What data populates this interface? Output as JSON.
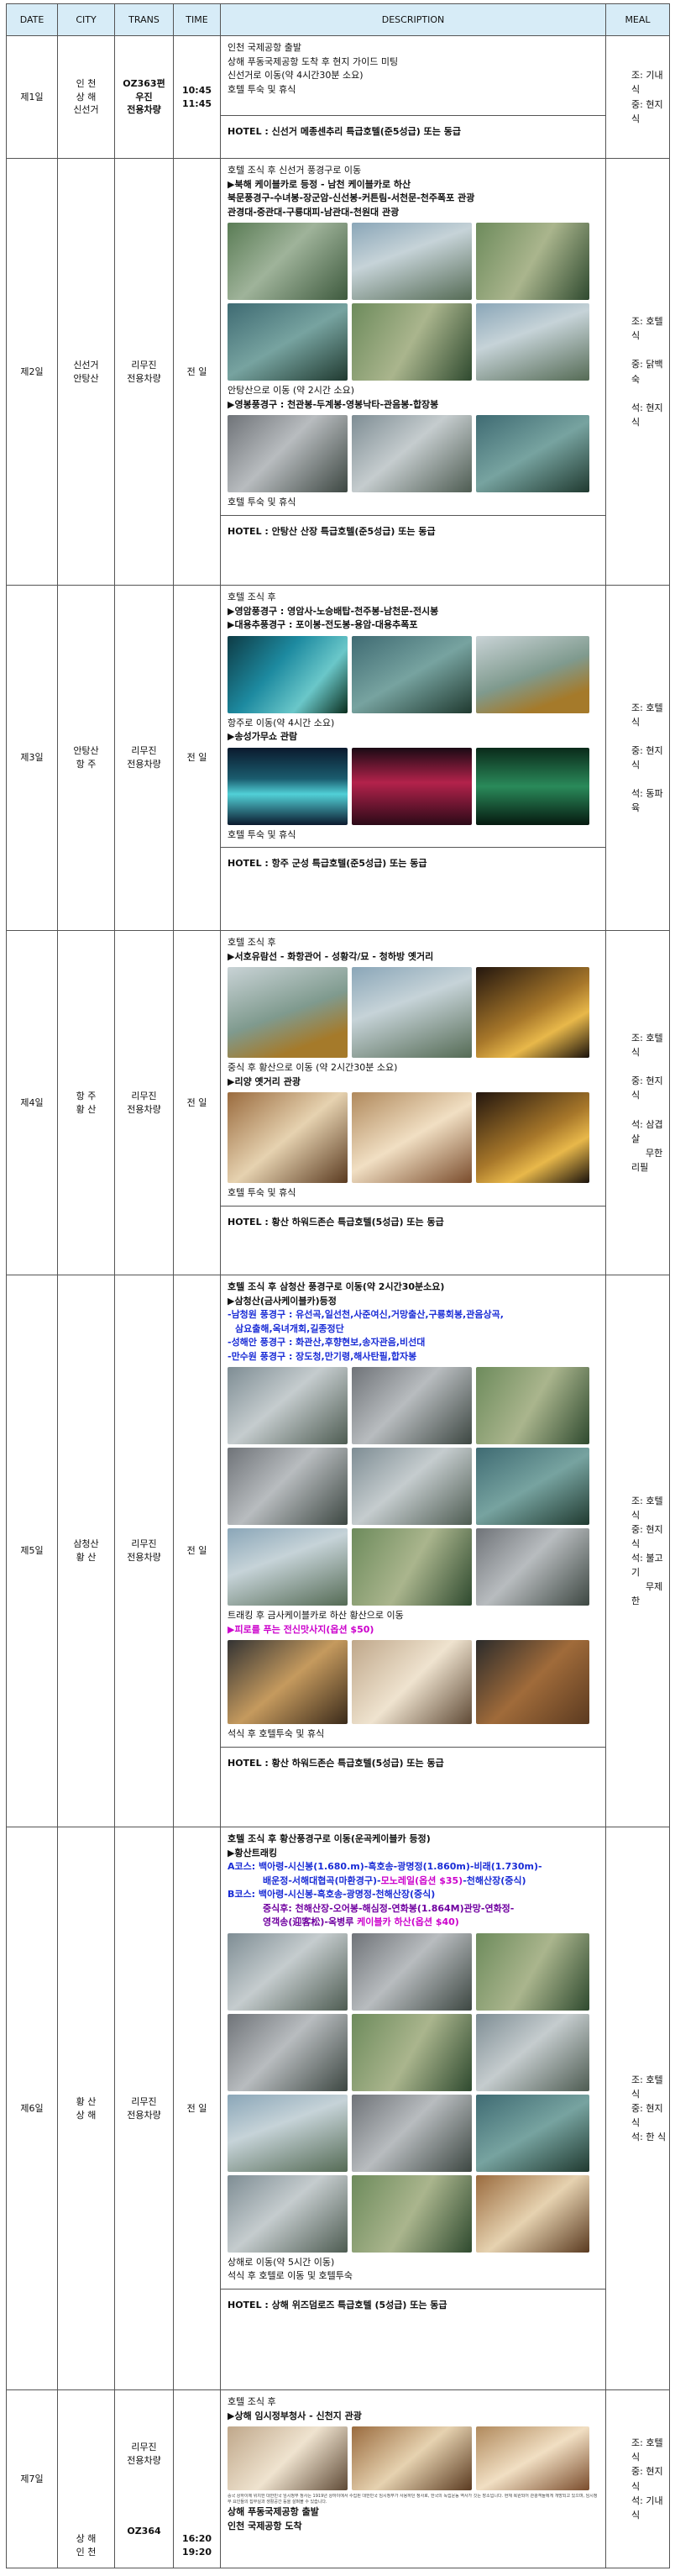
{
  "headers": [
    "DATE",
    "CITY",
    "TRANS",
    "TIME",
    "DESCRIPTION",
    "MEAL"
  ],
  "day1": {
    "date": "제1일",
    "city": [
      "인 천",
      "상 해",
      "신선거"
    ],
    "trans": [
      "OZ363편",
      "우진",
      "전용차량"
    ],
    "time": [
      "10:45",
      "11:45"
    ],
    "lines": [
      "인천 국제공항 출발",
      "상해 푸동국제공항 도착 후 현지 가이드 미팅",
      "신선거로 이동(약 4시간30분 소요)",
      "호텔 투숙 및 휴식"
    ],
    "hotel": "HOTEL : 신선거 메종센추리 특급호텔(준5성급) 또는 동급",
    "meal": [
      "조: 기내식",
      "중: 현지식"
    ]
  },
  "day2": {
    "date": "제2일",
    "city": [
      "신선거",
      "안탕산"
    ],
    "trans": [
      "리무진",
      "전용차량"
    ],
    "time": "전 일",
    "l1": "호텔 조식 후 신선거 풍경구로 이동",
    "l2": "▶북해 케이블카로 등정 - 남천 케이블카로 하산",
    "l3": "북문풍경구-수녀봉-장군암-신선봉-커튼림-서천문-천주폭포 관광",
    "l4": "관경대-중관대-구룡대피-남관대-천원대 관광",
    "l5": "안탕산으로 이동 (약 2시간 소요)",
    "l6": "▶영봉풍경구 : 천관봉-두계봉-영봉낙타-관음봉-합장봉",
    "l7": "호텔 투숙 및 휴식",
    "hotel": "HOTEL : 안탕산 산장 특급호텔(준5성급) 또는 동급",
    "meal": [
      "조: 호텔식",
      "중: 닭백숙",
      "석: 현지식"
    ]
  },
  "day3": {
    "date": "제3일",
    "city": [
      "안탕산",
      "항 주"
    ],
    "trans": [
      "리무진",
      "전용차량"
    ],
    "time": "전 일",
    "l1": "호텔 조식 후",
    "l2": "▶영암풍경구 : 영암사-노승배탑-천주봉-남천문-전시봉",
    "l3": "▶대용추풍경구 : 포이봉-전도봉-용암-대용추폭포",
    "l4": "항주로 이동(약 4시간 소요)",
    "l5": "▶송성가무쇼 관람",
    "l6": "호텔 투숙 및 휴식",
    "hotel": "HOTEL : 항주 군성 특급호텔(준5성급) 또는 동급",
    "meal": [
      "조: 호텔식",
      "중: 현지식",
      "석: 동파육"
    ]
  },
  "day4": {
    "date": "제4일",
    "city": [
      "항 주",
      "황 산"
    ],
    "trans": [
      "리무진",
      "전용차량"
    ],
    "time": "전 일",
    "l1": "호텔 조식 후",
    "l2": "▶서호유람선 - 화항관어 - 성황각/묘 - 청하방 옛거리",
    "l3": "중식 후 황산으로 이동 (약 2시간30분 소요)",
    "l4": "▶리양 옛거리 관광",
    "l5": "호텔 투숙 및 휴식",
    "hotel": "HOTEL : 황산 하워드존슨 특급호텔(5성급) 또는 동급",
    "meal": [
      "조: 호텔식",
      "중: 현지식",
      "석: 삼겹살",
      "무한리필"
    ]
  },
  "day5": {
    "date": "제5일",
    "city": [
      "삼청산",
      "황 산"
    ],
    "trans": [
      "리무진",
      "전용차량"
    ],
    "time": "전 일",
    "l1": "호텔 조식 후 삼청산 풍경구로 이동(약 2시간30분소요)",
    "l2": "▶삼청산(금사케이블카)등정",
    "l3": "-남청원 풍경구 : 유선곡,일선천,사준여신,거망출산,구룡회봉,관음상곡,",
    "l4": "삼요출해,옥녀개회,길종정단",
    "l5": "-성해안 풍경구 : 화관산,후향현보,송자관음,비선대",
    "l6": "-만수원 풍경구 : 장도청,만기령,해사탄필,합자봉",
    "l7": "트래킹 후 금사케이블카로 하산 황산으로 이동",
    "l8": "▶피로를 푸는 전신맛사지(옵션 $50)",
    "l9": "석식 후 호텔투숙 및 휴식",
    "hotel": "HOTEL : 황산 하워드존슨 특급호텔(5성급) 또는 동급",
    "meal": [
      "조: 호텔식",
      "중: 현지식",
      "석: 불고기",
      "무제한"
    ]
  },
  "day6": {
    "date": "제6일",
    "city": [
      "황 산",
      "상 해"
    ],
    "trans": [
      "리무진",
      "전용차량"
    ],
    "time": "전 일",
    "l1": "호텔 조식 후 황산풍경구로 이동(운곡케이블카 등정)",
    "l2": "▶황산트래킹",
    "a1": "A코스: 백아령-시신봉(1.680.m)-흑호송-광명정(1.860m)-비래(1.730m)-",
    "a2": "배운정-서해대협곡(마환경구)-",
    "a2opt": "모노레일(옵션 $35)",
    "a2end": "-천해산장(중식)",
    "b1": "B코스: 백아령-시신봉-흑호송-광명정-천해산장(중식)",
    "b2": "중식후: 천해산장-오어봉-해심정-연화봉(1.864M)관망-연화정-",
    "b3": "영객송(迎客松)-옥병루 ",
    "b3opt": "케이블카 하산(옵션 $40)",
    "l3": "상해로 이동(약 5시간 이동)",
    "l4": "석식 후 호텔로 이동 및 호텔투숙",
    "hotel": "HOTEL : 상해 위즈덤로즈 특급호텔 (5성급) 또는 동급",
    "meal": [
      "조: 호텔식",
      "중: 현지식",
      "석: 한 식"
    ]
  },
  "day7": {
    "date": "제7일",
    "trans_top": [
      "리무진",
      "전용차량"
    ],
    "city_bottom": [
      "상 해",
      "인 천"
    ],
    "trans_bottom": "OZ364",
    "time": [
      "16:20",
      "19:20"
    ],
    "l1": "호텔 조식 후",
    "l2": "▶상해 임시정부청사 - 신천지 관광",
    "note": "중국 상하이에 위치한 대한민국 임시정부 청사는 1919년 상하이에서 수립된 대한민국 임시정부가 사용하던 청사로, 한국의 독립운동 역사가 깃든 장소입니다. 현재 복원되어 관광객들에게 개방되고 있으며, 임시정부 요인들의 집무실과 생활공간 등을 살펴볼 수 있습니다.",
    "l3": "상해 푸동국제공항 출발",
    "l4": "인천 국제공항 도착",
    "meal": [
      "조: 호텔식",
      "중: 현지식",
      "석: 기내식"
    ]
  }
}
